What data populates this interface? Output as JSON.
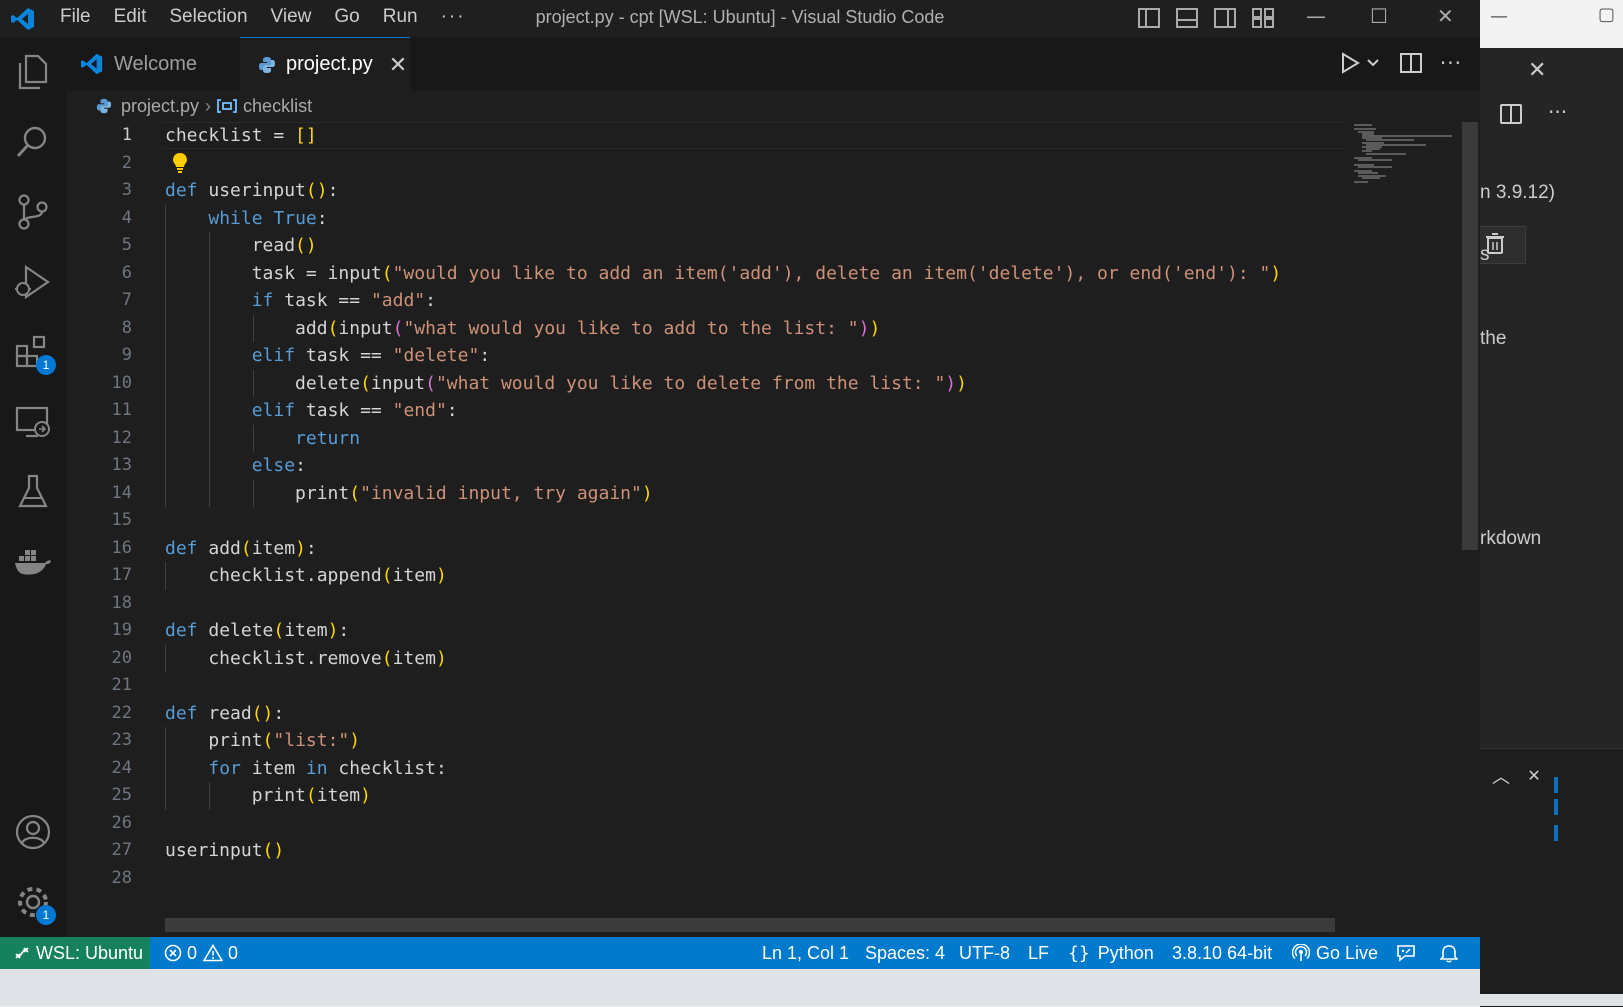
{
  "window": {
    "title": "project.py - cpt [WSL: Ubuntu] - Visual Studio Code",
    "menu": [
      "File",
      "Edit",
      "Selection",
      "View",
      "Go",
      "Run",
      "···"
    ]
  },
  "activity_bar": {
    "extensions_badge": "1",
    "settings_badge": "1"
  },
  "tabs": [
    {
      "label": "Welcome",
      "icon": "vscode-logo-icon",
      "active": false
    },
    {
      "label": "project.py",
      "icon": "python-file-icon",
      "active": true,
      "close": "✕"
    }
  ],
  "breadcrumb": {
    "file": "project.py",
    "symbol": "checklist"
  },
  "editor": {
    "language": "python",
    "line_numbers": [
      "1",
      "2",
      "3",
      "4",
      "5",
      "6",
      "7",
      "8",
      "9",
      "10",
      "11",
      "12",
      "13",
      "14",
      "15",
      "16",
      "17",
      "18",
      "19",
      "20",
      "21",
      "22",
      "23",
      "24",
      "25",
      "26",
      "27",
      "28"
    ],
    "active_line": "1",
    "strings": {
      "s_add_prompt": "\"would you like to add an item('add'), delete an item('delete'), or end('end'): \"",
      "s_add": "\"add\"",
      "s_add_list": "\"what would you like to add to the list: \"",
      "s_delete": "\"delete\"",
      "s_delete_list": "\"what would you like to delete from the list: \"",
      "s_end": "\"end\"",
      "s_invalid": "\"invalid input, try again\"",
      "s_list": "\"list:\""
    }
  },
  "background_window": {
    "text_version": "n 3.9.12)",
    "text_s": "s",
    "text_the": "the",
    "text_markdown": "rkdown"
  },
  "status_bar": {
    "remote": "WSL: Ubuntu",
    "errors": "0",
    "warnings": "0",
    "position": "Ln 1, Col 1",
    "spaces": "Spaces: 4",
    "encoding": "UTF-8",
    "eol": "LF",
    "language": "Python",
    "interpreter": "3.8.10 64-bit",
    "live": "Go Live"
  },
  "colors": {
    "status_bar": "#007acc",
    "remote_indicator": "#16825d",
    "keyword": "#569cd6",
    "string": "#ce9178",
    "bracket": "#ffd700"
  }
}
